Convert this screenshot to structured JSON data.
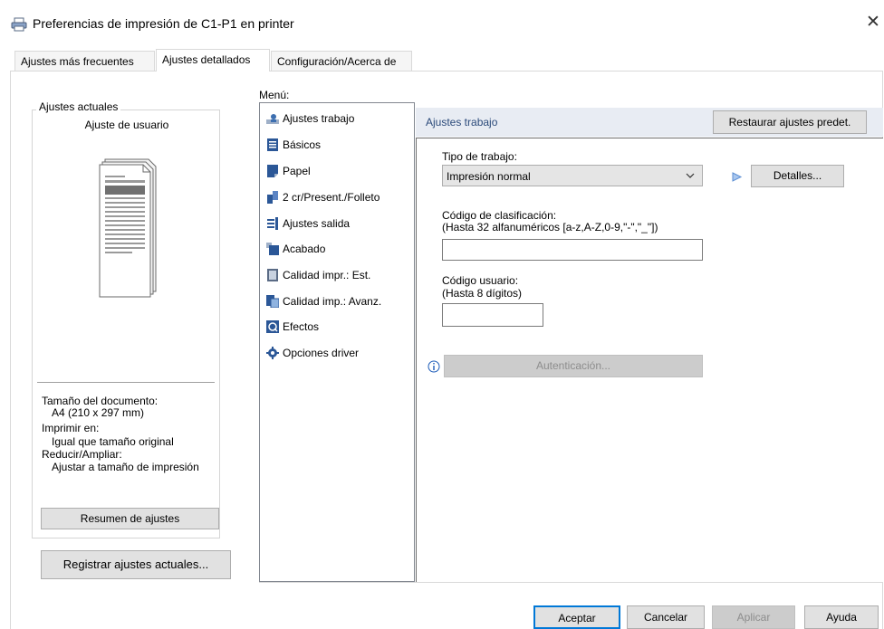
{
  "window": {
    "title": "Preferencias de impresión de C1-P1 en printer"
  },
  "tabs": [
    {
      "label": "Ajustes más frecuentes"
    },
    {
      "label": "Ajustes detallados"
    },
    {
      "label": "Configuración/Acerca de"
    }
  ],
  "left_panel": {
    "group_title": "Ajustes actuales",
    "setting_value": "Ajuste de usuario",
    "info_lines": [
      "Tamaño del documento:",
      "A4 (210 x 297 mm)",
      "Imprimir en:",
      "Igual que tamaño original",
      "Reducir/Ampliar:",
      "Ajustar a tamaño de impresión"
    ],
    "summary_button": "Resumen de ajustes",
    "register_button": "Registrar ajustes actuales..."
  },
  "menu": {
    "label": "Menú:",
    "items": [
      {
        "label": "Ajustes trabajo",
        "icon": "job-settings-icon"
      },
      {
        "label": "Básicos",
        "icon": "basic-icon"
      },
      {
        "label": "Papel",
        "icon": "paper-icon"
      },
      {
        "label": "2 cr/Present./Folleto",
        "icon": "duplex-icon"
      },
      {
        "label": "Ajustes salida",
        "icon": "output-icon"
      },
      {
        "label": "Acabado",
        "icon": "finishing-icon"
      },
      {
        "label": "Calidad impr.: Est.",
        "icon": "quality-standard-icon"
      },
      {
        "label": "Calidad imp.: Avanz.",
        "icon": "quality-advanced-icon"
      },
      {
        "label": "Efectos",
        "icon": "effects-icon"
      },
      {
        "label": "Opciones driver",
        "icon": "driver-options-icon"
      }
    ]
  },
  "panel": {
    "title": "Ajustes trabajo",
    "restore_button": "Restaurar ajustes predet.",
    "job_type_label": "Tipo de trabajo:",
    "job_type_value": "Impresión normal",
    "details_button": "Detalles...",
    "classification_label": "Código de clasificación:",
    "classification_hint": "(Hasta 32 alfanuméricos [a-z,A-Z,0-9,\"-\",\"_\"])",
    "classification_value": "",
    "user_code_label": "Código usuario:",
    "user_code_hint": "(Hasta 8 dígitos)",
    "user_code_value": "",
    "auth_button": "Autenticación..."
  },
  "footer": {
    "ok": "Aceptar",
    "cancel": "Cancelar",
    "apply": "Aplicar",
    "help": "Ayuda"
  },
  "colors": {
    "accent": "#0078d7",
    "header_bg": "#e8ecf3",
    "button_bg": "#e1e1e1",
    "disabled_text": "#8d8d8d"
  }
}
